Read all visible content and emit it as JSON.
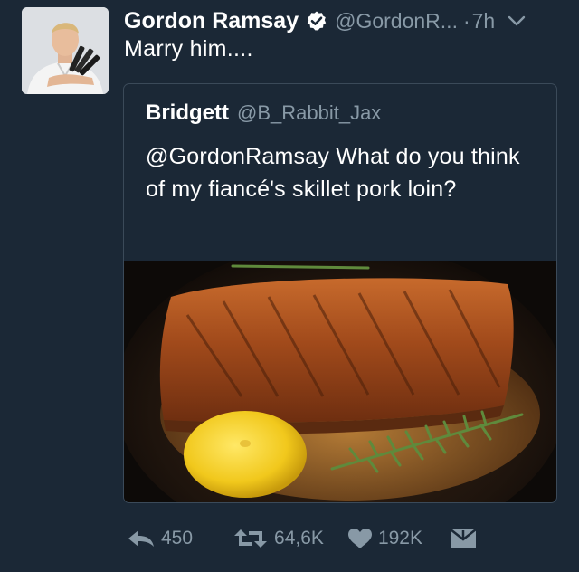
{
  "author": {
    "display_name": "Gordon Ramsay",
    "handle": "@GordonR...",
    "separator": "·",
    "time": "7h",
    "verified": true,
    "avatar_icon": "profile-photo"
  },
  "tweet": {
    "text": "Marry him...."
  },
  "quoted": {
    "display_name": "Bridgett",
    "handle": "@B_Rabbit_Jax",
    "text": "@GordonRamsay What do you think of my fiancé's skillet pork loin?",
    "media_icon": "food-photo"
  },
  "actions": {
    "reply_count": "450",
    "retweet_count": "64,6K",
    "like_count": "192K"
  },
  "colors": {
    "background": "#1b2836",
    "secondary_text": "#8899a6",
    "verified_badge": "#ffffff",
    "border": "#3b4a59"
  }
}
